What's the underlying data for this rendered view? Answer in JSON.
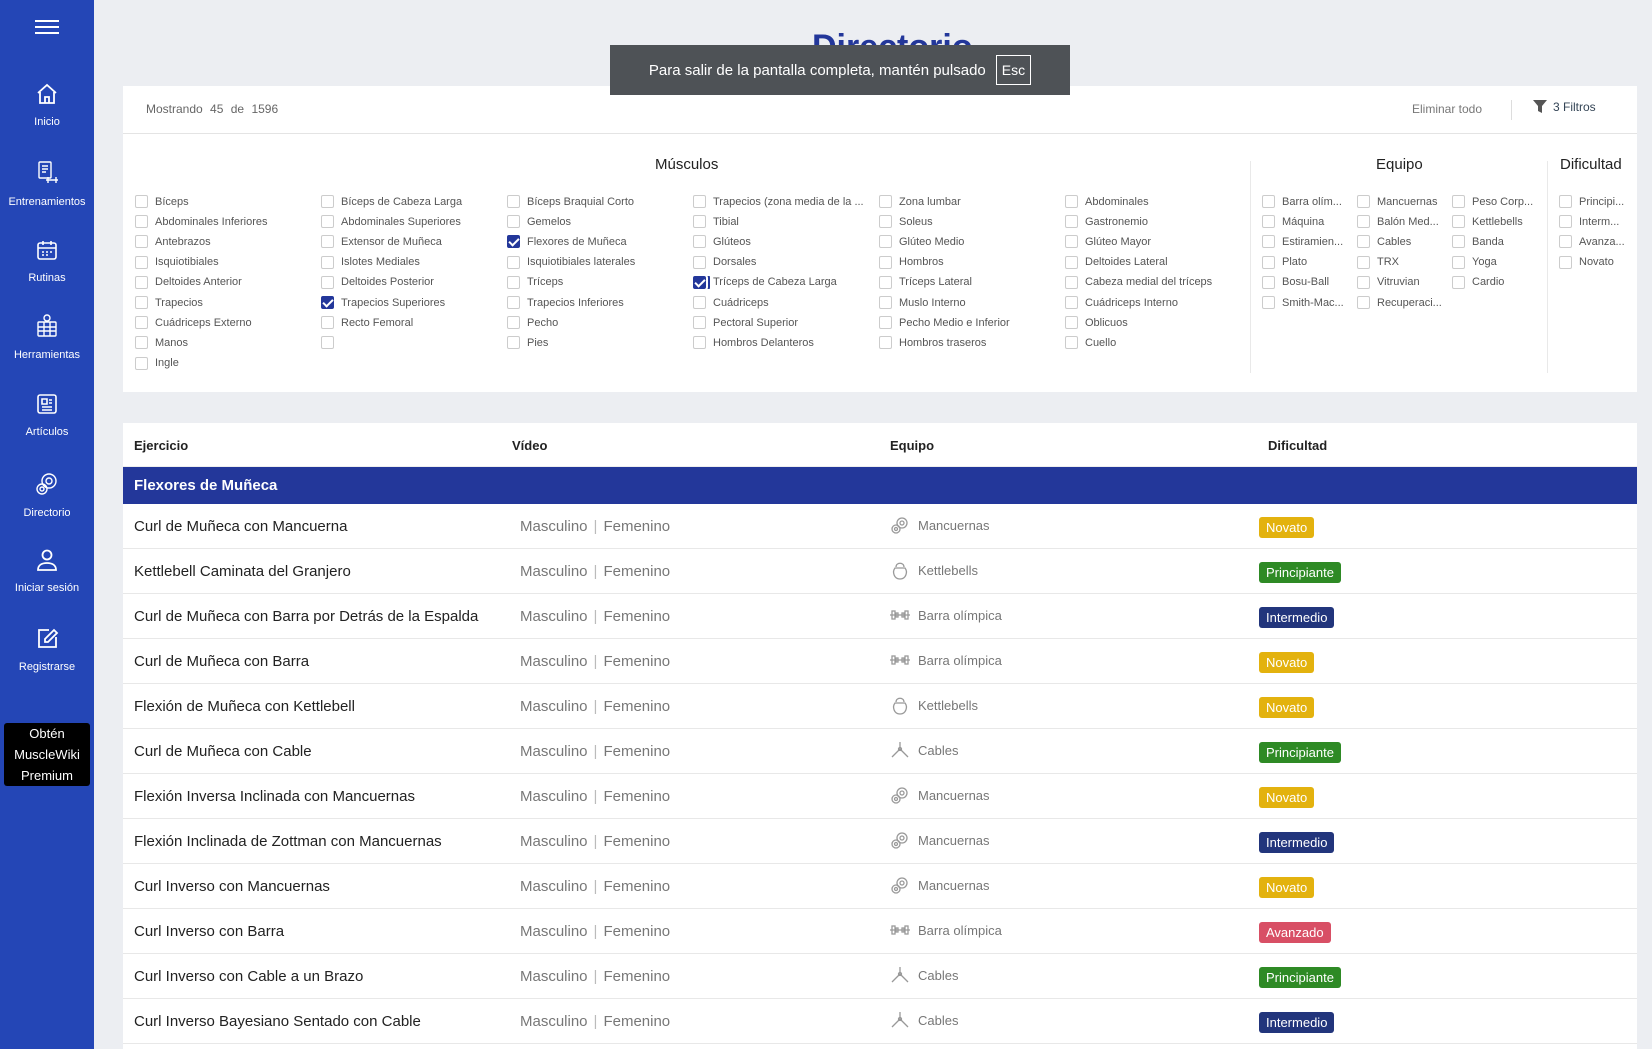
{
  "sidebar": {
    "items": [
      {
        "label": "Inicio",
        "icon": "home-icon"
      },
      {
        "label": "Entrenamientos",
        "icon": "workout-icon"
      },
      {
        "label": "Rutinas",
        "icon": "calendar-icon"
      },
      {
        "label": "Herramientas",
        "icon": "tools-icon"
      },
      {
        "label": "Artículos",
        "icon": "article-icon"
      },
      {
        "label": "Directorio",
        "icon": "directory-icon"
      },
      {
        "label": "Iniciar sesión",
        "icon": "user-icon"
      },
      {
        "label": "Registrarse",
        "icon": "edit-icon"
      }
    ],
    "premium": [
      "Obtén",
      "MuscleWiki",
      "Premium"
    ]
  },
  "page_title": "Directorio",
  "fullscreen_notice": {
    "text": "Para salir de la pantalla completa, mantén pulsado",
    "key": "Esc"
  },
  "filters": {
    "showing": {
      "label": "Mostrando",
      "count": "45",
      "of": "de",
      "total": "1596"
    },
    "clear_all": "Eliminar todo",
    "filter_count": "3 Filtros",
    "muscles": {
      "title": "Músculos",
      "columns": [
        [
          {
            "label": "Bíceps",
            "checked": false
          },
          {
            "label": "Abdominales Inferiores",
            "checked": false
          },
          {
            "label": "Antebrazos",
            "checked": false
          },
          {
            "label": "Isquiotibiales",
            "checked": false
          },
          {
            "label": "Deltoides Anterior",
            "checked": false
          },
          {
            "label": "Trapecios",
            "checked": false
          },
          {
            "label": "Cuádriceps Externo",
            "checked": false
          },
          {
            "label": "Manos",
            "checked": false
          },
          {
            "label": "Ingle",
            "checked": false
          }
        ],
        [
          {
            "label": "Bíceps de Cabeza Larga",
            "checked": false
          },
          {
            "label": "Abdominales Superiores",
            "checked": false
          },
          {
            "label": "Extensor de Muñeca",
            "checked": false
          },
          {
            "label": "Islotes Mediales",
            "checked": false
          },
          {
            "label": "Deltoides Posterior",
            "checked": false
          },
          {
            "label": "Trapecios Superiores",
            "checked": true
          },
          {
            "label": "Recto Femoral",
            "checked": false
          },
          {
            "label": "",
            "checked": false
          }
        ],
        [
          {
            "label": "Bíceps Braquial Corto",
            "checked": false
          },
          {
            "label": "Gemelos",
            "checked": false
          },
          {
            "label": "Flexores de Muñeca",
            "checked": true
          },
          {
            "label": "Isquiotibiales laterales",
            "checked": false
          },
          {
            "label": "Tríceps",
            "checked": false
          },
          {
            "label": "Trapecios Inferiores",
            "checked": false
          },
          {
            "label": "Pecho",
            "checked": false
          },
          {
            "label": "Pies",
            "checked": false
          }
        ],
        [
          {
            "label": "Trapecios (zona media de la ...",
            "checked": false
          },
          {
            "label": "Tibial",
            "checked": false
          },
          {
            "label": "Glúteos",
            "checked": false
          },
          {
            "label": "Dorsales",
            "checked": false
          },
          {
            "label": "Tríceps de Cabeza Larga",
            "checked": true,
            "focus": true
          },
          {
            "label": "Cuádriceps",
            "checked": false
          },
          {
            "label": "Pectoral Superior",
            "checked": false
          },
          {
            "label": "Hombros Delanteros",
            "checked": false
          }
        ],
        [
          {
            "label": "Zona lumbar",
            "checked": false
          },
          {
            "label": "Soleus",
            "checked": false
          },
          {
            "label": "Glúteo Medio",
            "checked": false
          },
          {
            "label": "Hombros",
            "checked": false
          },
          {
            "label": "Tríceps Lateral",
            "checked": false
          },
          {
            "label": "Muslo Interno",
            "checked": false
          },
          {
            "label": "Pecho Medio e Inferior",
            "checked": false
          },
          {
            "label": "Hombros traseros",
            "checked": false
          }
        ],
        [
          {
            "label": "Abdominales",
            "checked": false
          },
          {
            "label": "Gastronemio",
            "checked": false
          },
          {
            "label": "Glúteo Mayor",
            "checked": false
          },
          {
            "label": "Deltoides Lateral",
            "checked": false
          },
          {
            "label": "Cabeza medial del tríceps",
            "checked": false
          },
          {
            "label": "Cuádriceps Interno",
            "checked": false
          },
          {
            "label": "Oblicuos",
            "checked": false
          },
          {
            "label": "Cuello",
            "checked": false
          }
        ]
      ]
    },
    "equipment": {
      "title": "Equipo",
      "columns": [
        [
          {
            "label": "Barra olím...",
            "checked": false
          },
          {
            "label": "Máquina",
            "checked": false
          },
          {
            "label": "Estiramien...",
            "checked": false
          },
          {
            "label": "Plato",
            "checked": false
          },
          {
            "label": "Bosu-Ball",
            "checked": false
          },
          {
            "label": "Smith-Mac...",
            "checked": false
          }
        ],
        [
          {
            "label": "Mancuernas",
            "checked": false
          },
          {
            "label": "Balón Med...",
            "checked": false
          },
          {
            "label": "Cables",
            "checked": false
          },
          {
            "label": "TRX",
            "checked": false
          },
          {
            "label": "Vitruvian",
            "checked": false
          },
          {
            "label": "Recuperaci...",
            "checked": false
          }
        ],
        [
          {
            "label": "Peso Corp...",
            "checked": false
          },
          {
            "label": "Kettlebells",
            "checked": false
          },
          {
            "label": "Banda",
            "checked": false
          },
          {
            "label": "Yoga",
            "checked": false
          },
          {
            "label": "Cardio",
            "checked": false
          }
        ]
      ]
    },
    "difficulty": {
      "title": "Dificultad",
      "items": [
        {
          "label": "Principi...",
          "checked": false
        },
        {
          "label": "Interm...",
          "checked": false
        },
        {
          "label": "Avanza...",
          "checked": false
        },
        {
          "label": "Novato",
          "checked": false
        }
      ]
    }
  },
  "table": {
    "headers": {
      "exercise": "Ejercicio",
      "video": "Vídeo",
      "equipment": "Equipo",
      "difficulty": "Dificultad"
    },
    "group": "Flexores de Muñeca",
    "video_male": "Masculino",
    "video_female": "Femenino",
    "rows": [
      {
        "name": "Curl de Muñeca con Mancuerna",
        "equipment": "Mancuernas",
        "equip_icon": "dumbbell-icon",
        "difficulty": "Novato",
        "level": "nov"
      },
      {
        "name": "Kettlebell Caminata del Granjero",
        "equipment": "Kettlebells",
        "equip_icon": "kettlebell-icon",
        "difficulty": "Principiante",
        "level": "pri"
      },
      {
        "name": "Curl de Muñeca con Barra por Detrás de la Espalda",
        "equipment": "Barra olímpica",
        "equip_icon": "barbell-icon",
        "difficulty": "Intermedio",
        "level": "int"
      },
      {
        "name": "Curl de Muñeca con Barra",
        "equipment": "Barra olímpica",
        "equip_icon": "barbell-icon",
        "difficulty": "Novato",
        "level": "nov"
      },
      {
        "name": "Flexión de Muñeca con Kettlebell",
        "equipment": "Kettlebells",
        "equip_icon": "kettlebell-icon",
        "difficulty": "Novato",
        "level": "nov"
      },
      {
        "name": "Curl de Muñeca con Cable",
        "equipment": "Cables",
        "equip_icon": "cable-icon",
        "difficulty": "Principiante",
        "level": "pri"
      },
      {
        "name": "Flexión Inversa Inclinada con Mancuernas",
        "equipment": "Mancuernas",
        "equip_icon": "dumbbell-icon",
        "difficulty": "Novato",
        "level": "nov"
      },
      {
        "name": "Flexión Inclinada de Zottman con Mancuernas",
        "equipment": "Mancuernas",
        "equip_icon": "dumbbell-icon",
        "difficulty": "Intermedio",
        "level": "int"
      },
      {
        "name": "Curl Inverso con Mancuernas",
        "equipment": "Mancuernas",
        "equip_icon": "dumbbell-icon",
        "difficulty": "Novato",
        "level": "nov"
      },
      {
        "name": "Curl Inverso con Barra",
        "equipment": "Barra olímpica",
        "equip_icon": "barbell-icon",
        "difficulty": "Avanzado",
        "level": "ava"
      },
      {
        "name": "Curl Inverso con Cable a un Brazo",
        "equipment": "Cables",
        "equip_icon": "cable-icon",
        "difficulty": "Principiante",
        "level": "pri"
      },
      {
        "name": "Curl Inverso Bayesiano Sentado con Cable",
        "equipment": "Cables",
        "equip_icon": "cable-icon",
        "difficulty": "Intermedio",
        "level": "int"
      }
    ]
  },
  "colors": {
    "sidebar": "#2446b6",
    "group_bar": "#23379a",
    "novato": "#e3b20e",
    "principiante": "#2e8a25",
    "intermedio": "#22357c",
    "avanzado": "#d84f65"
  }
}
